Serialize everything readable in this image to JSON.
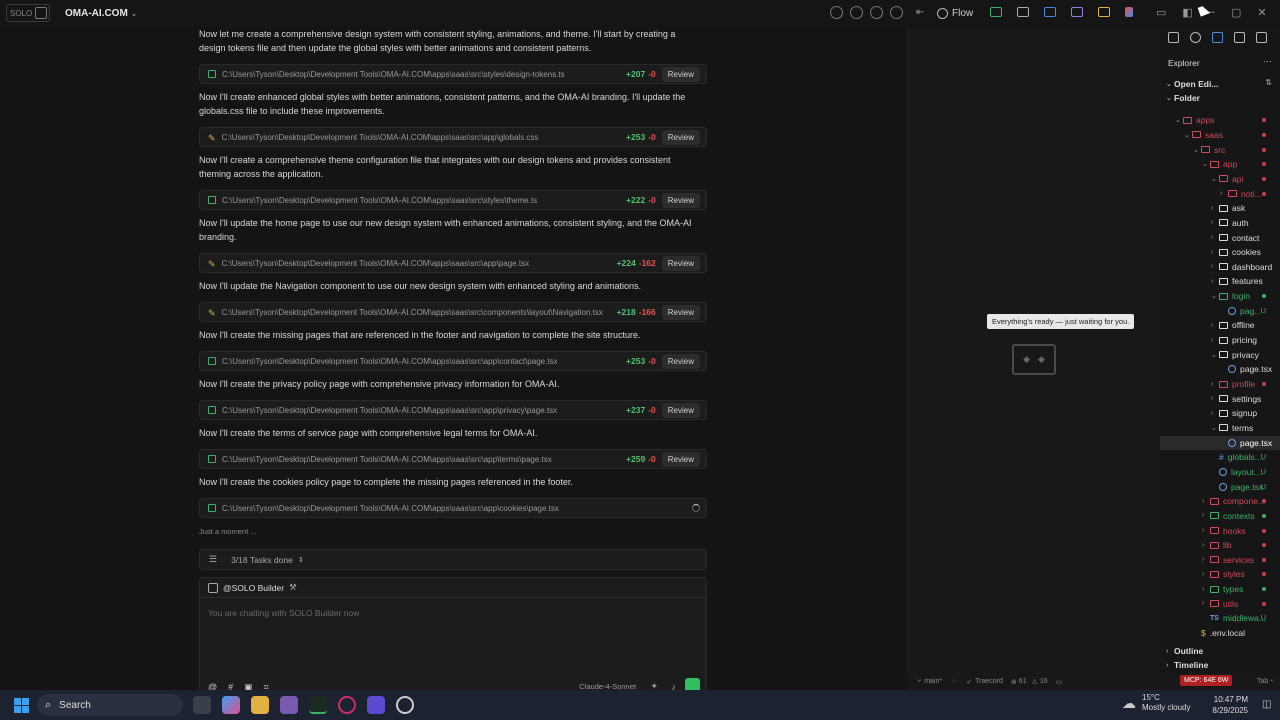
{
  "app": {
    "logo": "SOLO",
    "project": "OMA-AI.COM"
  },
  "toolbar": {
    "flow": "Flow"
  },
  "chat": {
    "messages": [
      {
        "text": "Now let me create a comprehensive design system with consistent styling, animations, and theme. I'll start by creating a design tokens file and then update the global styles with better animations and consistent patterns.",
        "file": {
          "path": "C:\\Users\\Tyson\\Desktop\\Development Tools\\OMA-AI.COM\\apps\\saas\\src\\styles\\design-tokens.ts",
          "add": "+207",
          "del": "-0",
          "icon": "file-new"
        }
      },
      {
        "text": "Now I'll create enhanced global styles with better animations, consistent patterns, and the OMA-AI branding. I'll update the globals.css file to include these improvements.",
        "file": {
          "path": "C:\\Users\\Tyson\\Desktop\\Development Tools\\OMA-AI.COM\\apps\\saas\\src\\app\\globals.css",
          "add": "+253",
          "del": "-0",
          "icon": "file-edit"
        }
      },
      {
        "text": "Now I'll create a comprehensive theme configuration file that integrates with our design tokens and provides consistent theming across the application.",
        "file": {
          "path": "C:\\Users\\Tyson\\Desktop\\Development Tools\\OMA-AI.COM\\apps\\saas\\src\\styles\\theme.ts",
          "add": "+222",
          "del": "-0",
          "icon": "file-new"
        }
      },
      {
        "text": "Now I'll update the home page to use our new design system with enhanced animations, consistent styling, and the OMA-AI branding.",
        "file": {
          "path": "C:\\Users\\Tyson\\Desktop\\Development Tools\\OMA-AI.COM\\apps\\saas\\src\\app\\page.tsx",
          "add": "+224",
          "del": "-162",
          "icon": "file-edit"
        }
      },
      {
        "text": "Now I'll update the Navigation component to use our new design system with enhanced styling and animations.",
        "file": {
          "path": "C:\\Users\\Tyson\\Desktop\\Development Tools\\OMA-AI.COM\\apps\\saas\\src\\components\\layout\\Navigation.tsx",
          "add": "+218",
          "del": "-166",
          "icon": "file-edit"
        }
      },
      {
        "text": "Now I'll create the missing pages that are referenced in the footer and navigation to complete the site structure.",
        "file": {
          "path": "C:\\Users\\Tyson\\Desktop\\Development Tools\\OMA-AI.COM\\apps\\saas\\src\\app\\contact\\page.tsx",
          "add": "+253",
          "del": "-0",
          "icon": "file-new"
        }
      },
      {
        "text": "Now I'll create the privacy policy page with comprehensive privacy information for OMA-AI.",
        "file": {
          "path": "C:\\Users\\Tyson\\Desktop\\Development Tools\\OMA-AI.COM\\apps\\saas\\src\\app\\privacy\\page.tsx",
          "add": "+237",
          "del": "-0",
          "icon": "file-new"
        }
      },
      {
        "text": "Now I'll create the terms of service page with comprehensive legal terms for OMA-AI.",
        "file": {
          "path": "C:\\Users\\Tyson\\Desktop\\Development Tools\\OMA-AI.COM\\apps\\saas\\src\\app\\terms\\page.tsx",
          "add": "+259",
          "del": "-0",
          "icon": "file-new"
        }
      },
      {
        "text": "Now I'll create the cookies policy page to complete the missing pages referenced in the footer.",
        "file": {
          "path": "C:\\Users\\Tyson\\Desktop\\Development Tools\\OMA-AI.COM\\apps\\saas\\src\\app\\cookies\\page.tsx",
          "add": "",
          "del": "",
          "icon": "file-new",
          "loading": true
        }
      }
    ],
    "review_label": "Review",
    "status": "Just a moment ...",
    "tasks": "3/18 Tasks done",
    "agent": "@SOLO Builder",
    "placeholder": "You are chatting with SOLO Builder now",
    "model": "Claude-4-Sonnet"
  },
  "preview": {
    "tooltip": "Everything's ready — just waiting for you."
  },
  "explorer": {
    "title": "Explorer",
    "rows": [
      {
        "label": "Open Edi...",
        "d": 0,
        "type": "section",
        "open": true
      },
      {
        "label": "Folder",
        "d": 0,
        "type": "section",
        "open": true
      },
      {
        "label": "apps",
        "d": 1,
        "type": "folder",
        "open": true,
        "color": "#d04a5a",
        "mark": "dot"
      },
      {
        "label": "saas",
        "d": 2,
        "type": "folder",
        "open": true,
        "color": "#d04a5a",
        "mark": "dot"
      },
      {
        "label": "src",
        "d": 3,
        "type": "folder",
        "open": true,
        "color": "#d04a5a",
        "mark": "dot"
      },
      {
        "label": "app",
        "d": 4,
        "type": "folder",
        "open": true,
        "color": "#d04a5a",
        "mark": "dot"
      },
      {
        "label": "api",
        "d": 5,
        "type": "folder",
        "open": true,
        "color": "#d04a5a",
        "mark": "dot"
      },
      {
        "label": "noti...",
        "d": 6,
        "type": "folder",
        "open": false,
        "color": "#d04a5a",
        "mark": "dot"
      },
      {
        "label": "ask",
        "d": 5,
        "type": "folder",
        "open": false,
        "color": "#dddddd"
      },
      {
        "label": "auth",
        "d": 5,
        "type": "folder",
        "open": false,
        "color": "#dddddd"
      },
      {
        "label": "contact",
        "d": 5,
        "type": "folder",
        "open": false,
        "color": "#dddddd"
      },
      {
        "label": "cookies",
        "d": 5,
        "type": "folder",
        "open": false,
        "color": "#dddddd"
      },
      {
        "label": "dashboard",
        "d": 5,
        "type": "folder",
        "open": false,
        "color": "#dddddd"
      },
      {
        "label": "features",
        "d": 5,
        "type": "folder",
        "open": false,
        "color": "#dddddd"
      },
      {
        "label": "login",
        "d": 5,
        "type": "folder",
        "open": true,
        "color": "#3fb06a",
        "mark": "dot-green"
      },
      {
        "label": "pag...",
        "d": 6,
        "type": "file",
        "color": "#3fb06a",
        "mark": "U"
      },
      {
        "label": "offline",
        "d": 5,
        "type": "folder",
        "open": false,
        "color": "#dddddd"
      },
      {
        "label": "pricing",
        "d": 5,
        "type": "folder",
        "open": false,
        "color": "#dddddd"
      },
      {
        "label": "privacy",
        "d": 5,
        "type": "folder",
        "open": true,
        "color": "#dddddd"
      },
      {
        "label": "page.tsx",
        "d": 6,
        "type": "file",
        "color": "#dddddd"
      },
      {
        "label": "profile",
        "d": 5,
        "type": "folder",
        "open": false,
        "color": "#d04a5a",
        "mark": "dot"
      },
      {
        "label": "settings",
        "d": 5,
        "type": "folder",
        "open": false,
        "color": "#dddddd"
      },
      {
        "label": "signup",
        "d": 5,
        "type": "folder",
        "open": false,
        "color": "#dddddd"
      },
      {
        "label": "terms",
        "d": 5,
        "type": "folder",
        "open": true,
        "color": "#dddddd"
      },
      {
        "label": "page.tsx",
        "d": 6,
        "type": "file",
        "color": "#ffffff",
        "selected": true
      },
      {
        "label": "globals....",
        "d": 5,
        "type": "hash",
        "color": "#3fb06a",
        "mark": "U"
      },
      {
        "label": "layout....",
        "d": 5,
        "type": "file",
        "color": "#3fb06a",
        "mark": "U"
      },
      {
        "label": "page.tsx",
        "d": 5,
        "type": "file",
        "color": "#3fb06a",
        "mark": "U"
      },
      {
        "label": "compone...",
        "d": 4,
        "type": "folder",
        "open": false,
        "color": "#d04a5a",
        "mark": "dot"
      },
      {
        "label": "contexts",
        "d": 4,
        "type": "folder",
        "open": false,
        "color": "#3fb06a",
        "mark": "dot-green"
      },
      {
        "label": "hooks",
        "d": 4,
        "type": "folder",
        "open": false,
        "color": "#d04a5a",
        "mark": "dot"
      },
      {
        "label": "lib",
        "d": 4,
        "type": "folder",
        "open": false,
        "color": "#d04a5a",
        "mark": "dot"
      },
      {
        "label": "services",
        "d": 4,
        "type": "folder",
        "open": false,
        "color": "#d04a5a",
        "mark": "dot"
      },
      {
        "label": "styles",
        "d": 4,
        "type": "folder",
        "open": false,
        "color": "#d04a5a",
        "mark": "dot"
      },
      {
        "label": "types",
        "d": 4,
        "type": "folder",
        "open": false,
        "color": "#3fb06a",
        "mark": "dot-green"
      },
      {
        "label": "utils",
        "d": 4,
        "type": "folder",
        "open": false,
        "color": "#d04a5a",
        "mark": "dot"
      },
      {
        "label": "middlewa...",
        "d": 4,
        "type": "ts",
        "color": "#3fb06a",
        "mark": "U"
      },
      {
        "label": ".env.local",
        "d": 3,
        "type": "env",
        "color": "#dddddd"
      }
    ],
    "outline": "Outline",
    "timeline": "Timeline"
  },
  "statusbar": {
    "branch": "main*",
    "traecord": "Traecord",
    "errors": "61",
    "warnings": "16",
    "mcp": "MCP: 64E 6W",
    "tab": "Tab"
  },
  "taskbar": {
    "search": "Search",
    "temp": "15°C",
    "weather": "Mostly cloudy",
    "time": "10:47 PM",
    "date": "8/29/2025"
  },
  "colors": {
    "accent": "#2fbf61",
    "add": "#4fc36f",
    "del": "#e05555",
    "alert": "#b02020"
  }
}
